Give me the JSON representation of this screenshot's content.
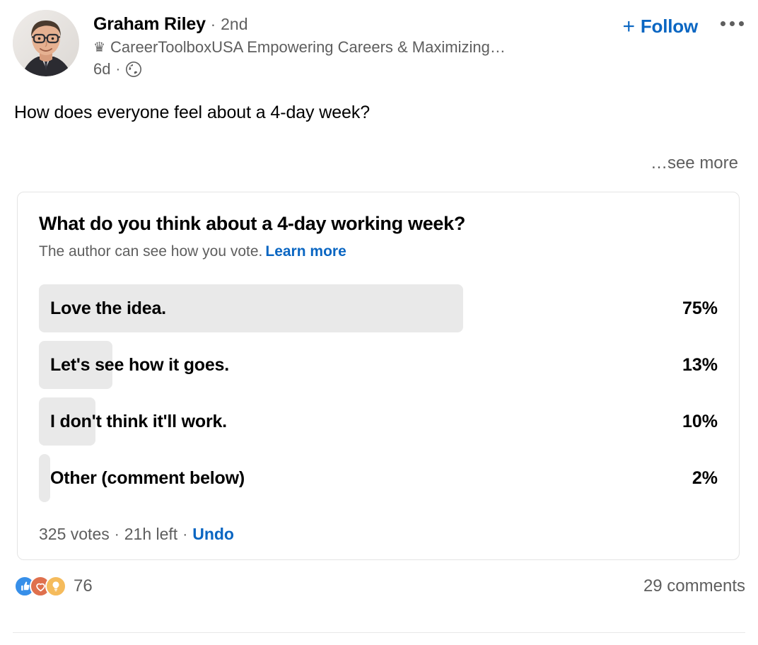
{
  "post": {
    "author": {
      "name": "Graham Riley",
      "separator": "·",
      "degree": "2nd",
      "headline": "CareerToolboxUSA Empowering Careers & Maximizing…",
      "crown_icon": "♛",
      "avatar_alt": "avatar"
    },
    "meta": {
      "timestamp": "6d",
      "separator": "·",
      "visibility_icon": "globe-icon"
    },
    "actions": {
      "follow_label": "Follow",
      "follow_plus": "+",
      "more_icon": "ellipsis-icon"
    },
    "body_text": "How does everyone feel about a 4-day week?",
    "see_more_label": "…see more"
  },
  "poll": {
    "question": "What do you think about a 4-day working week?",
    "subtitle": "The author can see how you vote.",
    "learn_more_label": "Learn more",
    "options": [
      {
        "label": "Love the idea.",
        "percent": "75%",
        "value": 75
      },
      {
        "label": "Let's see how it goes.",
        "percent": "13%",
        "value": 13
      },
      {
        "label": "I don't think it'll work.",
        "percent": "10%",
        "value": 10
      },
      {
        "label": "Other (comment below)",
        "percent": "2%",
        "value": 2
      }
    ],
    "footer": {
      "votes": "325 votes",
      "separator_1": "·",
      "time_left": "21h left",
      "separator_2": "·",
      "undo_label": "Undo"
    }
  },
  "social": {
    "reaction_count": "76",
    "reactions": [
      "like-icon",
      "love-icon",
      "insight-icon"
    ],
    "comments": "29 comments"
  },
  "colors": {
    "link_blue": "#0a66c2",
    "bar_grey": "#e9e9e9",
    "text_muted": "#5e5e5e",
    "reaction_like": "#378fe9",
    "reaction_love": "#df704d",
    "reaction_insight": "#f5bb5c"
  }
}
